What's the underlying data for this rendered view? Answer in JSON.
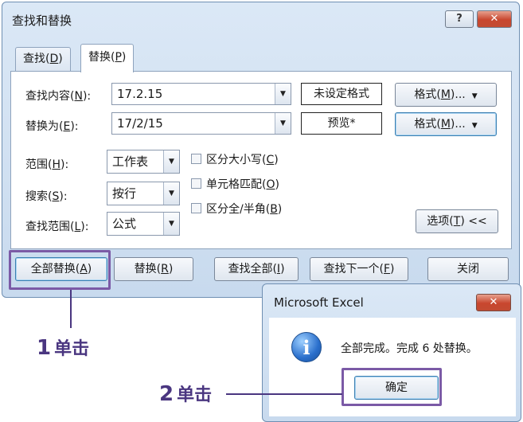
{
  "dialog": {
    "title": "查找和替换",
    "help_label": "?",
    "close_label": "✕",
    "tabs": [
      {
        "prefix": "查找(",
        "key": "D",
        "suffix": ")"
      },
      {
        "prefix": "替换(",
        "key": "P",
        "suffix": ")"
      }
    ],
    "find": {
      "label_prefix": "查找内容(",
      "label_key": "N",
      "label_suffix": "):",
      "value": "17.2.15",
      "format_preview": "未设定格式"
    },
    "replace": {
      "label_prefix": "替换为(",
      "label_key": "E",
      "label_suffix": "):",
      "value": "17/2/15",
      "format_preview": "预览*"
    },
    "format_button": {
      "prefix": "格式(",
      "key": "M",
      "suffix": ")..."
    },
    "within": {
      "label_prefix": "范围(",
      "label_key": "H",
      "label_suffix": "):",
      "value": "工作表"
    },
    "search": {
      "label_prefix": "搜索(",
      "label_key": "S",
      "label_suffix": "):",
      "value": "按行"
    },
    "look_in": {
      "label_prefix": "查找范围(",
      "label_key": "L",
      "label_suffix": "):",
      "value": "公式"
    },
    "checkboxes": [
      {
        "prefix": "区分大小写(",
        "key": "C",
        "suffix": ")",
        "checked": false
      },
      {
        "prefix": "单元格匹配(",
        "key": "O",
        "suffix": ")",
        "checked": false
      },
      {
        "prefix": "区分全/半角(",
        "key": "B",
        "suffix": ")",
        "checked": false
      }
    ],
    "options_button": {
      "prefix": "选项(",
      "key": "T",
      "suffix": ") <<"
    },
    "buttons": {
      "replace_all": {
        "prefix": "全部替换(",
        "key": "A",
        "suffix": ")"
      },
      "replace": {
        "prefix": "替换(",
        "key": "R",
        "suffix": ")"
      },
      "find_all": {
        "prefix": "查找全部(",
        "key": "I",
        "suffix": ")"
      },
      "find_next": {
        "prefix": "查找下一个(",
        "key": "F",
        "suffix": ")"
      },
      "close": "关闭"
    }
  },
  "message_box": {
    "title": "Microsoft Excel",
    "close_label": "✕",
    "icon": "info-icon",
    "text": "全部完成。完成 6 处替换。",
    "ok_label": "确定"
  },
  "annotations": [
    {
      "number": "1",
      "text": "单击"
    },
    {
      "number": "2",
      "text": "单击"
    }
  ],
  "colors": {
    "annotation": "#4a3680",
    "highlight": "#7b5aa6",
    "dialog_bg": "#c8daee",
    "close_button": "#c8462e"
  }
}
